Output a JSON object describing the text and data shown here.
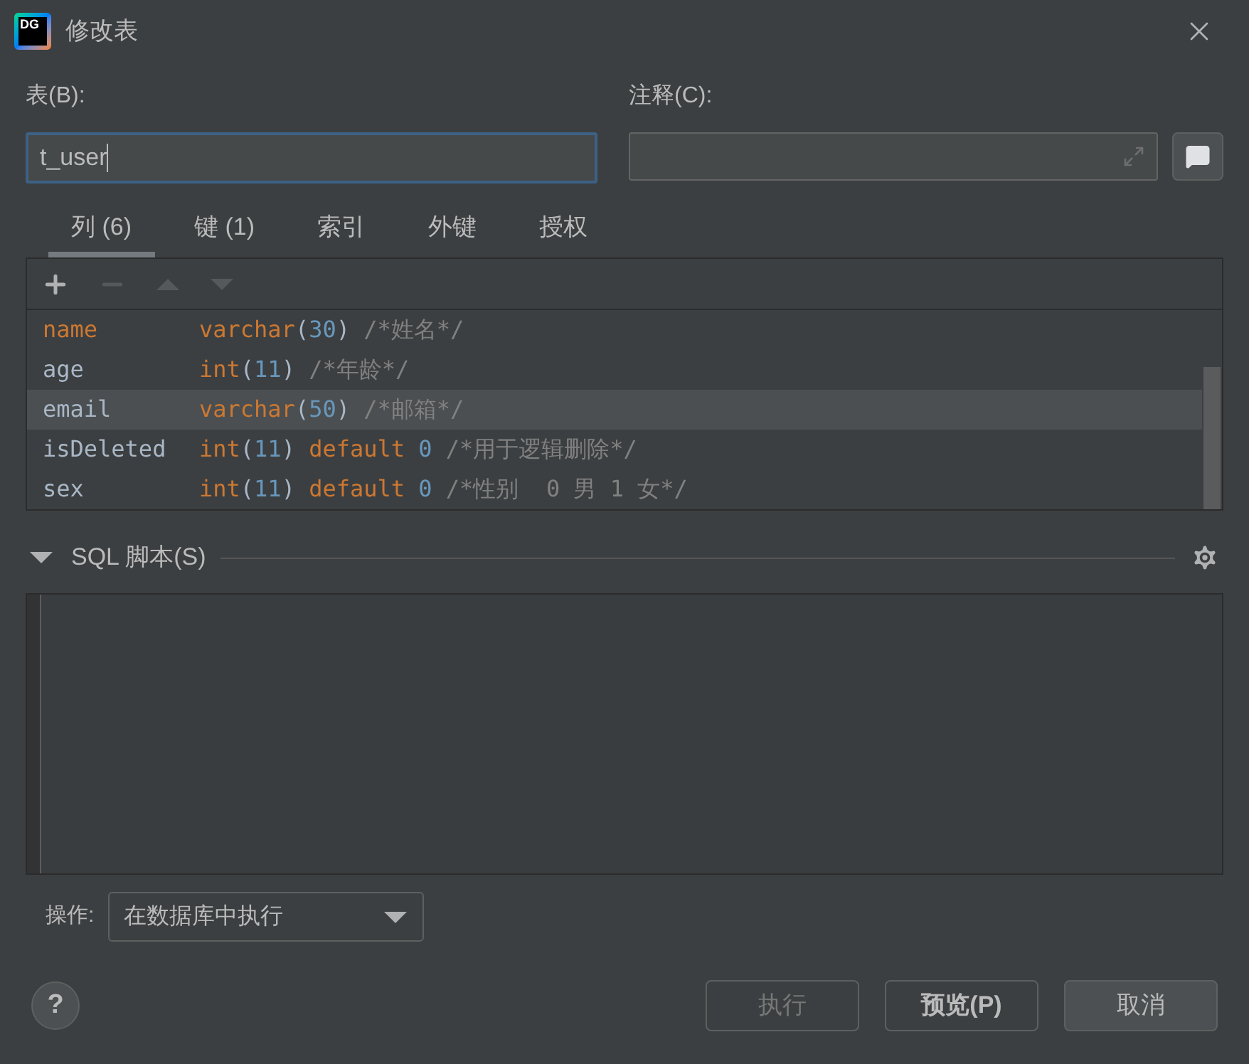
{
  "window": {
    "title": "修改表",
    "logo": "DG"
  },
  "table_field": {
    "label": "表(B):",
    "value": "t_user"
  },
  "comment_field": {
    "label": "注释(C):"
  },
  "tabs": [
    {
      "label": "列 (6)",
      "selected": true
    },
    {
      "label": "键 (1)",
      "selected": false
    },
    {
      "label": "索引",
      "selected": false
    },
    {
      "label": "外键",
      "selected": false
    },
    {
      "label": "授权",
      "selected": false
    }
  ],
  "toolbar": [
    {
      "kind": "add",
      "disabled": false
    },
    {
      "kind": "remove",
      "disabled": true
    },
    {
      "kind": "up",
      "disabled": true
    },
    {
      "kind": "down",
      "disabled": true
    }
  ],
  "columns": [
    {
      "name": "name",
      "selected": false,
      "tokens": [
        {
          "kind": "keyword",
          "text": "varchar"
        },
        {
          "kind": "punct",
          "text": "("
        },
        {
          "kind": "number",
          "text": "30"
        },
        {
          "kind": "punct",
          "text": ") "
        },
        {
          "kind": "comment",
          "text": "/*姓名*/"
        }
      ]
    },
    {
      "name": "age",
      "selected": false,
      "tokens": [
        {
          "kind": "keyword",
          "text": "int"
        },
        {
          "kind": "punct",
          "text": "("
        },
        {
          "kind": "number",
          "text": "11"
        },
        {
          "kind": "punct",
          "text": ") "
        },
        {
          "kind": "comment",
          "text": "/*年龄*/"
        }
      ]
    },
    {
      "name": "email",
      "selected": true,
      "tokens": [
        {
          "kind": "keyword",
          "text": "varchar"
        },
        {
          "kind": "punct",
          "text": "("
        },
        {
          "kind": "number",
          "text": "50"
        },
        {
          "kind": "punct",
          "text": ") "
        },
        {
          "kind": "comment",
          "text": "/*邮箱*/"
        }
      ]
    },
    {
      "name": "isDeleted",
      "selected": false,
      "tokens": [
        {
          "kind": "keyword",
          "text": "int"
        },
        {
          "kind": "punct",
          "text": "("
        },
        {
          "kind": "number",
          "text": "11"
        },
        {
          "kind": "punct",
          "text": ") "
        },
        {
          "kind": "keyword",
          "text": "default "
        },
        {
          "kind": "number",
          "text": "0 "
        },
        {
          "kind": "comment",
          "text": "/*用于逻辑删除*/"
        }
      ]
    },
    {
      "name": "sex",
      "selected": false,
      "tokens": [
        {
          "kind": "keyword",
          "text": "int"
        },
        {
          "kind": "punct",
          "text": "("
        },
        {
          "kind": "number",
          "text": "11"
        },
        {
          "kind": "punct",
          "text": ") "
        },
        {
          "kind": "keyword",
          "text": "default "
        },
        {
          "kind": "number",
          "text": "0 "
        },
        {
          "kind": "comment",
          "text": "/*性别  0 男 1 女*/"
        }
      ]
    }
  ],
  "sql_section": {
    "title": "SQL 脚本(S)",
    "expanded": true
  },
  "action": {
    "label": "操作:",
    "value": "在数据库中执行"
  },
  "buttons": [
    {
      "label": "执行",
      "disabled": true,
      "default": false
    },
    {
      "label": "预览(P)",
      "disabled": false,
      "default": false
    },
    {
      "label": "取消",
      "disabled": false,
      "default": true
    }
  ],
  "help": "?"
}
